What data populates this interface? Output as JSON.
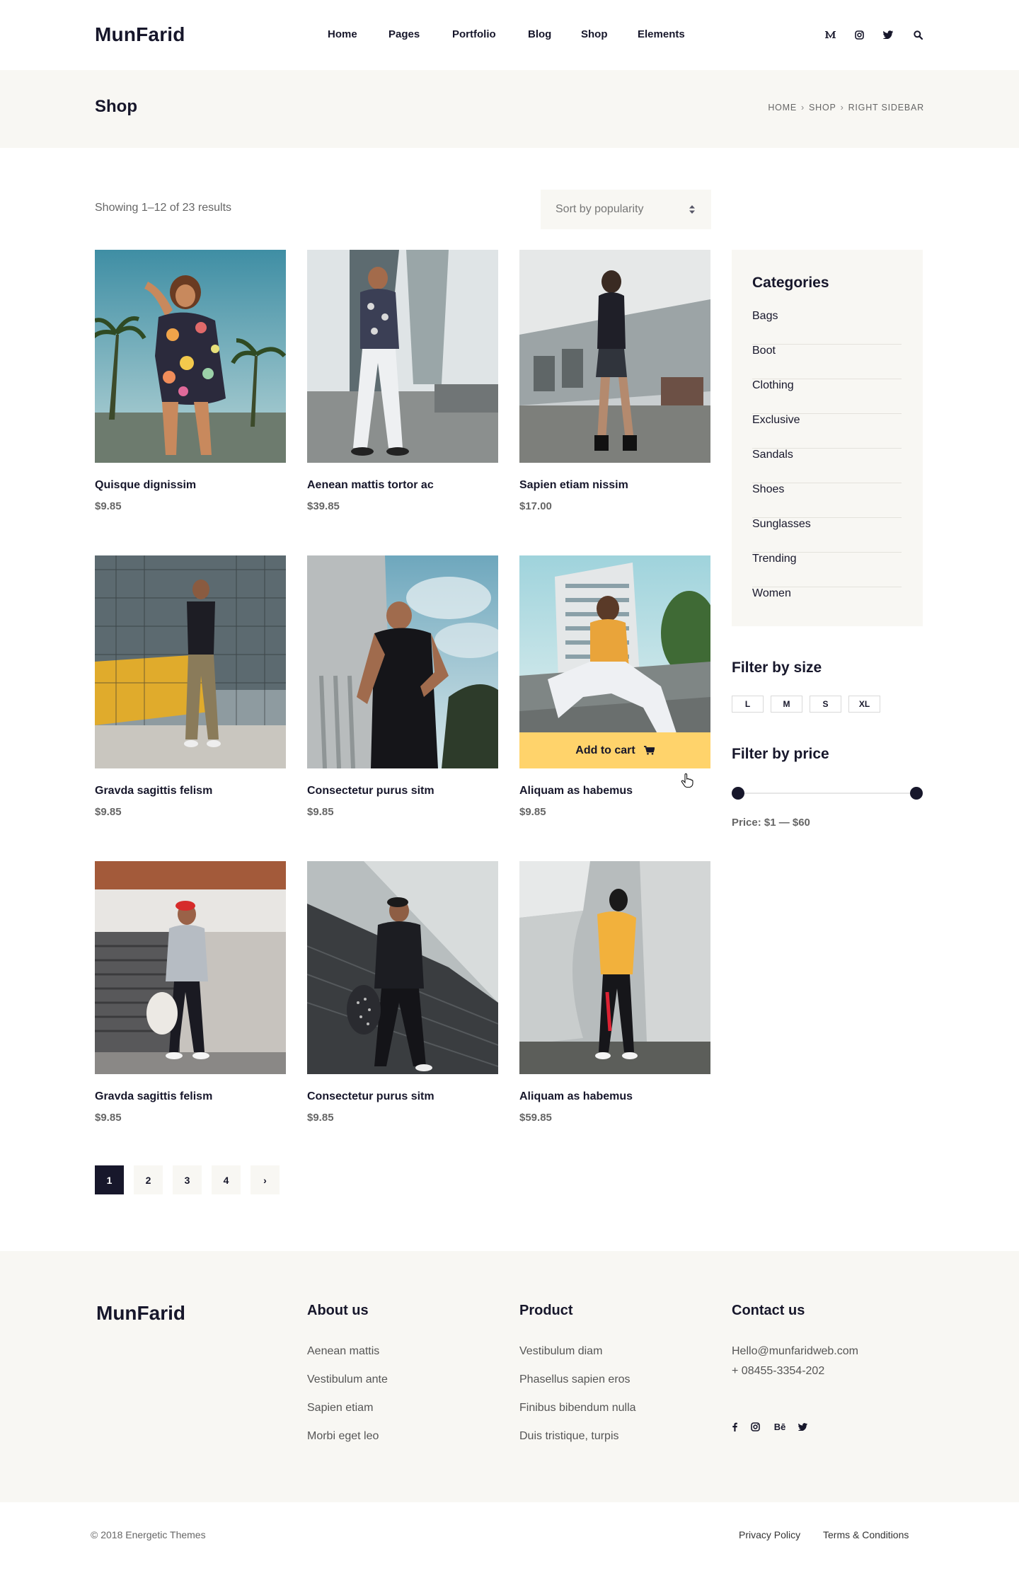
{
  "brand": {
    "logo": "MunFarid"
  },
  "nav": {
    "items": [
      "Home",
      "Pages",
      "Portfolio",
      "Blog",
      "Shop",
      "Elements"
    ]
  },
  "header_icons": [
    "medium-icon",
    "instagram-icon",
    "twitter-icon",
    "search-icon"
  ],
  "page": {
    "title": "Shop",
    "breadcrumb": [
      "HOME",
      "SHOP",
      "RIGHT SIDEBAR"
    ]
  },
  "toolbar": {
    "results": "Showing 1–12 of 23 results",
    "sort_label": "Sort by popularity"
  },
  "products": [
    {
      "name": "Quisque dignissim",
      "price": "$9.85"
    },
    {
      "name": "Aenean mattis tortor ac",
      "price": "$39.85"
    },
    {
      "name": "Sapien etiam nissim",
      "price": "$17.00"
    },
    {
      "name": "Gravda sagittis felism",
      "price": "$9.85"
    },
    {
      "name": "Consectetur purus sitm",
      "price": "$9.85"
    },
    {
      "name": "Aliquam as habemus",
      "price": "$9.85"
    },
    {
      "name": "Gravda sagittis felism",
      "price": "$9.85"
    },
    {
      "name": "Consectetur purus sitm",
      "price": "$9.85"
    },
    {
      "name": "Aliquam as habemus",
      "price": "$59.85"
    }
  ],
  "add_to_cart": {
    "label": "Add to cart"
  },
  "pagination": {
    "pages": [
      "1",
      "2",
      "3",
      "4",
      "›"
    ],
    "current": "1"
  },
  "sidebar": {
    "categories_title": "Categories",
    "categories": [
      "Bags",
      "Boot",
      "Clothing",
      "Exclusive",
      "Sandals",
      "Shoes",
      "Sunglasses",
      "Trending",
      "Women"
    ],
    "size_title": "Filter by size",
    "sizes": [
      "L",
      "M",
      "S",
      "XL"
    ],
    "price_title": "Filter by price",
    "price_range": "Price: $1 — $60"
  },
  "footer": {
    "logo": "MunFarid",
    "about": {
      "title": "About us",
      "links": [
        "Aenean mattis",
        "Vestibulum ante",
        "Sapien etiam",
        "Morbi eget leo"
      ]
    },
    "product": {
      "title": "Product",
      "links": [
        "Vestibulum diam",
        "Phasellus sapien eros",
        "Finibus bibendum nulla",
        "Duis tristique, turpis"
      ]
    },
    "contact": {
      "title": "Contact us",
      "email": "Hello@munfaridweb.com",
      "phone": "+ 08455-3354-202",
      "behance_label": "Bē"
    },
    "social_icons": [
      "facebook-icon",
      "instagram-icon",
      "behance-icon",
      "twitter-icon"
    ]
  },
  "bottom": {
    "copyright": "© 2018 Energetic Themes",
    "privacy": "Privacy Policy",
    "terms": "Terms & Conditions"
  },
  "colors": {
    "dark": "#17172b",
    "band": "#f8f7f3",
    "accent": "#ffd36b",
    "muted": "#666666"
  }
}
